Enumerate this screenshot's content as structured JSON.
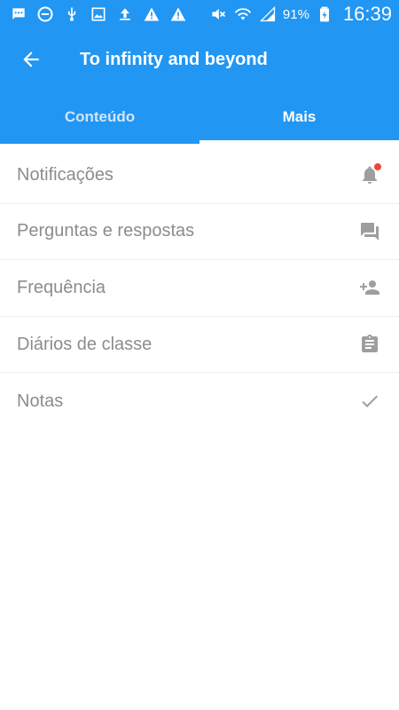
{
  "status_bar": {
    "battery": "91%",
    "time": "16:39",
    "icons_left": [
      "chat-icon",
      "block-icon",
      "usb-icon",
      "image-icon",
      "upload-icon",
      "warning-icon",
      "warning-icon"
    ],
    "icons_right": [
      "mute-icon",
      "wifi-icon",
      "signal-icon",
      "battery-icon"
    ]
  },
  "app_bar": {
    "title": "To infinity and beyond",
    "back_icon": "arrow-back-icon"
  },
  "tabs": [
    {
      "label": "Conteúdo",
      "active": false
    },
    {
      "label": "Mais",
      "active": true
    }
  ],
  "menu": {
    "items": [
      {
        "label": "Notificações",
        "icon": "bell-icon",
        "badge": true
      },
      {
        "label": "Perguntas e respostas",
        "icon": "forum-icon"
      },
      {
        "label": "Frequência",
        "icon": "person-add-icon"
      },
      {
        "label": "Diários de classe",
        "icon": "clipboard-icon"
      },
      {
        "label": "Notas",
        "icon": "check-icon"
      }
    ]
  },
  "colors": {
    "primary": "#2196f3",
    "badge": "#f44336",
    "text_muted": "#8c8c8c"
  }
}
